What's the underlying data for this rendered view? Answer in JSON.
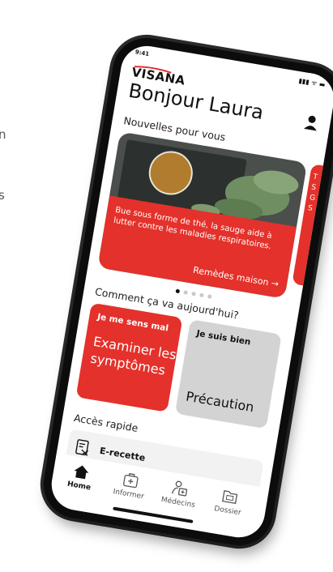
{
  "margin_text": [
    "n",
    "s"
  ],
  "status_bar": {
    "time": "9:41",
    "icons": "▮▮▮ ᯤ ▬"
  },
  "header": {
    "logo": "VISANA",
    "greeting": "Bonjour Laura"
  },
  "news": {
    "title": "Nouvelles pour vous",
    "card": {
      "text": "Bue sous forme de thé, la sauge aide à lutter contre les maladies respiratoires.",
      "link_label": "Remèdes maison →"
    },
    "next_card_text": [
      "T",
      "S",
      "G",
      "S"
    ],
    "dots_total": 5,
    "dots_active_index": 0
  },
  "mood": {
    "title": "Comment ça va aujourd'hui?",
    "bad": {
      "small": "Je me sens mal",
      "big": "Examiner les symptômes"
    },
    "good": {
      "small": "Je suis bien",
      "big": "Précaution"
    }
  },
  "quick_access": {
    "title": "Accès rapide",
    "items": [
      {
        "label": "E-recette",
        "icon": "prescription-icon"
      }
    ]
  },
  "tabs": [
    {
      "label": "Home",
      "icon": "home-icon",
      "active": true
    },
    {
      "label": "Informer",
      "icon": "info-icon",
      "active": false
    },
    {
      "label": "Médecins",
      "icon": "doctor-icon",
      "active": false
    },
    {
      "label": "Dossier",
      "icon": "dossier-icon",
      "active": false
    }
  ],
  "colors": {
    "brand_red": "#e4312b",
    "tile_grey": "#d3d3d3",
    "phone_black": "#0c0c0c"
  }
}
